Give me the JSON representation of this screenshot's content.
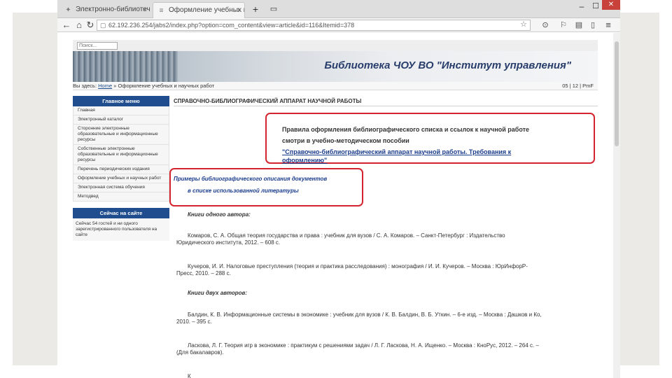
{
  "browser": {
    "tabs": [
      {
        "label": "Электронно-библиотечная с..."
      },
      {
        "label": "Оформление учебных и научн..."
      }
    ],
    "new_tab_symbol": "+",
    "tab_close_symbol": "×",
    "url": "62.192.236.254/jabs2/index.php?option=com_content&view=article&id=116&Itemid=378"
  },
  "site": {
    "search_placeholder": "Поиск...",
    "banner_title": "Библиотека ЧОУ ВО \"Институт управления\"",
    "breadcrumb_prefix": "Вы здесь:",
    "breadcrumb_home": "Home",
    "breadcrumb_sep": " » ",
    "breadcrumb_current": "Оформление учебных и научных работ",
    "date_badge": "05 | 12 | PmF"
  },
  "sidebar": {
    "menu_title": "Главное меню",
    "menu_items": [
      "Главная",
      "Электронный каталог",
      "Сторонние электронные образовательные и информационные ресурсы",
      "Собственные электронные образовательные и информационные ресурсы",
      "Перечень периодических издания",
      "Оформление учебных и научных работ",
      "Электронная система обучения",
      "Методвед"
    ],
    "online_title": "Сейчас на сайте",
    "online_text": "Сейчас 54 гостей и ни одного зарегистрированного пользователя на сайте"
  },
  "main": {
    "heading": "СПРАВОЧНО-БИБЛИОГРАФИЧЕСКИЙ АППАРАТ НАУЧНОЙ РАБОТЫ",
    "rules_line1": "Правила оформления библиографического списка и ссылок к научной работе",
    "rules_line2": "смотри в учебно-методическом пособии",
    "rules_link1": "\"Справочно-библиографический аппарат научной работы. Требования к",
    "rules_link2": "оформлению\"",
    "examples_line1": "Примеры библиографического описания документов",
    "examples_line2": "в списке использованной литературы",
    "section1": "Книги одного автора:",
    "ref1_line1": "Комаров, С. А. Общая теория государства и права : учебник для вузов / С. А. Комаров. – Санкт-Петербург : Издательство",
    "ref1_line2": "Юридического института, 2012. – 608 с.",
    "ref2_line1": "Кучеров, И. И. Налоговые преступления (теория и практика расследования) : монография / И. И. Кучеров. – Москва : ЮрИнфорР-",
    "ref2_line2": "Пресс, 2010. – 288 с.",
    "section2": "Книги двух авторов:",
    "ref3_line1": "Балдин, К. В. Информационные системы в экономике : учебник для вузов / К. В. Балдин, В. Б. Уткин. – 6-е изд. – Москва : Дашков и Ко,",
    "ref3_line2": "2010. – 395 с.",
    "ref4_line1": "Ласкова, Л. Г. Теория игр в экономике : практикум с решениями задач / Л. Г. Ласкова, Н. А. Ищенко. – Москва : КноРус, 2012. – 264 с. –",
    "ref4_line2": "(Для бакалавров).",
    "ref5_start": "К"
  },
  "colors": {
    "accent_blue": "#1f4d8e",
    "highlight_red": "#d4242e",
    "banner_title": "#283d6b"
  }
}
